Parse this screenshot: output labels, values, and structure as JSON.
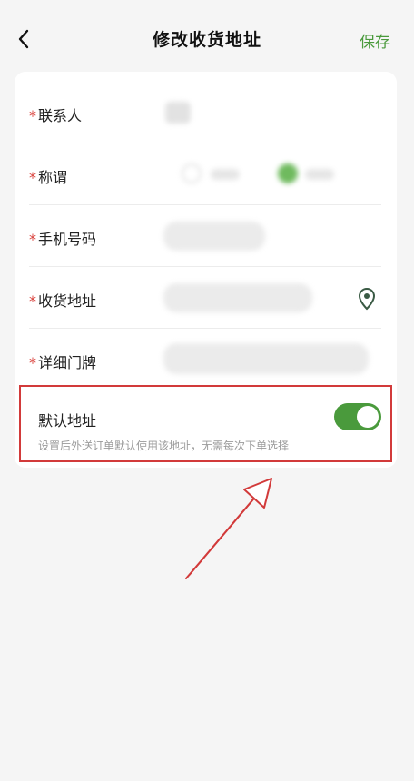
{
  "nav": {
    "title": "修改收货地址",
    "save_label": "保存"
  },
  "form": {
    "required_mark": "*",
    "fields": [
      {
        "label": "联系人"
      },
      {
        "label": "称谓"
      },
      {
        "label": "手机号码"
      },
      {
        "label": "收货地址"
      },
      {
        "label": "详细门牌"
      }
    ]
  },
  "default_address": {
    "title": "默认地址",
    "description": "设置后外送订单默认使用该地址，无需每次下单选择",
    "enabled": true
  },
  "colors": {
    "accent": "#4a9a3c",
    "required": "#d9403a",
    "highlight_border": "#d23a3a"
  },
  "icons": {
    "back": "chevron-left-icon",
    "location": "location-pin-icon"
  }
}
